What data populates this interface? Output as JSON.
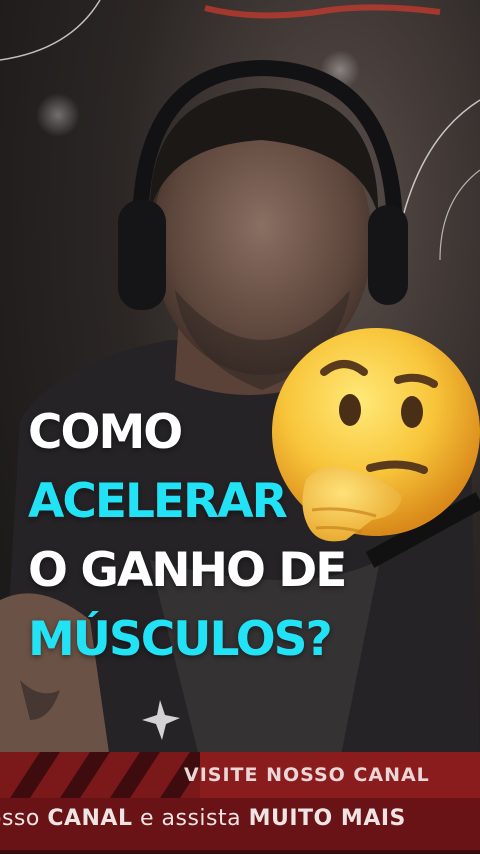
{
  "caption": {
    "line1": "COMO",
    "line2": "ACELERAR",
    "line3": "O GANHO DE",
    "line4": "MÚSCULOS?"
  },
  "banner": {
    "title": "VISITE NOSSO CANAL",
    "ticker": {
      "t1": "osso",
      "t2": "CANAL",
      "t3": "e assista",
      "t4": "MUITO MAIS"
    }
  },
  "emoji": {
    "icon": "thinking-face-icon"
  },
  "colors": {
    "white": "#ffffff",
    "cyan": "#22e3f5",
    "banner": "#8b1c1e"
  }
}
